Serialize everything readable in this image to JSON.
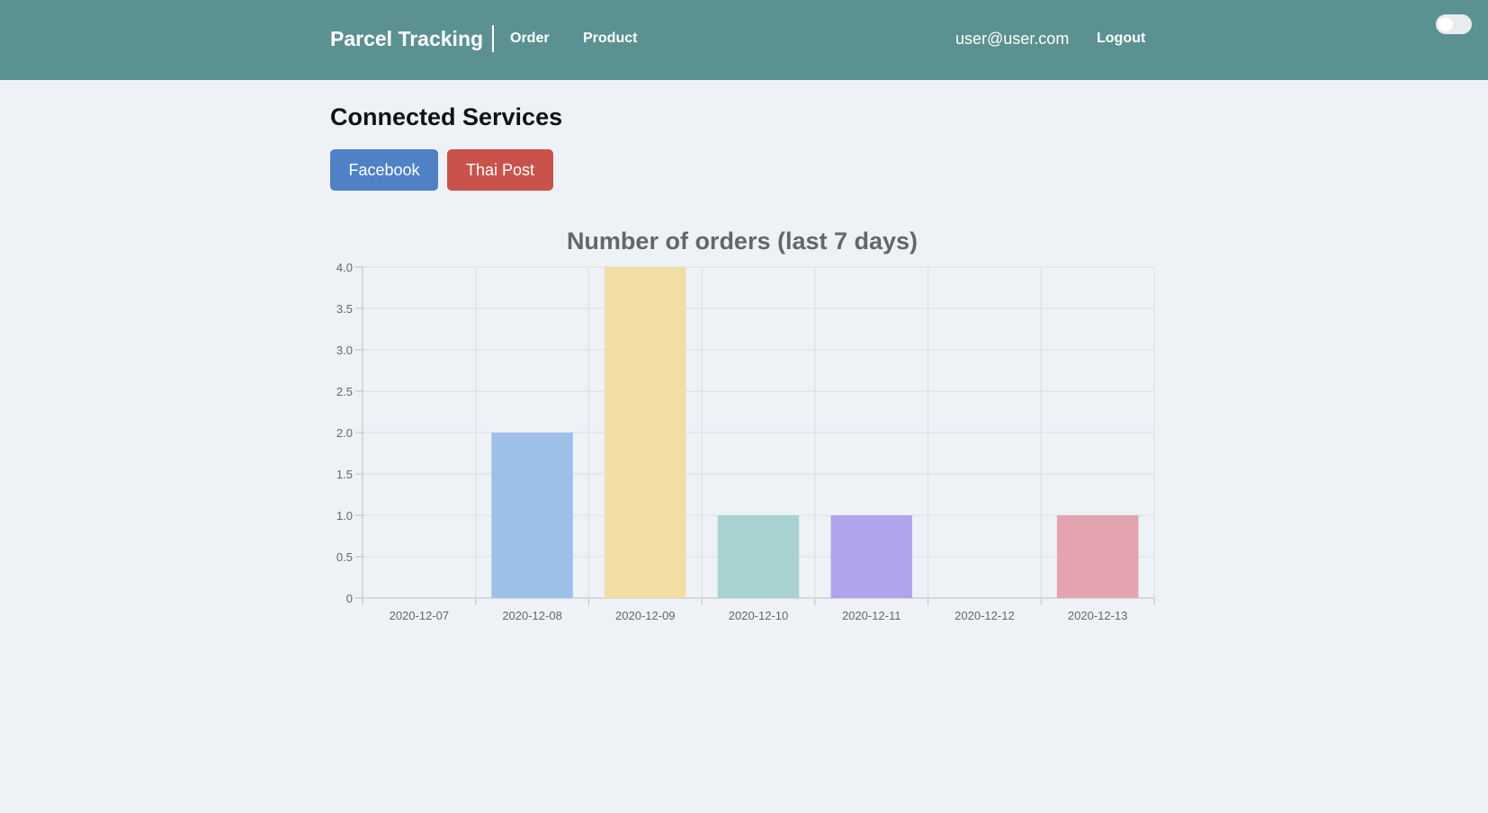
{
  "navbar": {
    "brand": "Parcel Tracking",
    "links": [
      {
        "label": "Order"
      },
      {
        "label": "Product"
      }
    ],
    "user_email": "user@user.com",
    "logout_label": "Logout",
    "background_color": "#5c9191",
    "theme_toggle": {
      "checked": false
    }
  },
  "main": {
    "title": "Connected Services",
    "services": [
      {
        "label": "Facebook",
        "color": "#4f81c7"
      },
      {
        "label": "Thai Post",
        "color": "#c9534a"
      }
    ]
  },
  "chart_data": {
    "type": "bar",
    "title": "Number of orders (last 7 days)",
    "xlabel": "",
    "ylabel": "",
    "categories": [
      "2020-12-07",
      "2020-12-08",
      "2020-12-09",
      "2020-12-10",
      "2020-12-11",
      "2020-12-12",
      "2020-12-13"
    ],
    "values": [
      0,
      2,
      4,
      1,
      1,
      0,
      1
    ],
    "colors": [
      "#e8a0a0",
      "#9dc0e9",
      "#f1dea5",
      "#a9d2d2",
      "#b1a4ee",
      "#c9cbcf",
      "#e3a4b0"
    ],
    "ylim": [
      0,
      4
    ],
    "yticks": [
      "0",
      "0.5",
      "1.0",
      "1.5",
      "2.0",
      "2.5",
      "3.0",
      "3.5",
      "4.0"
    ],
    "grid": true,
    "legend": "none"
  }
}
